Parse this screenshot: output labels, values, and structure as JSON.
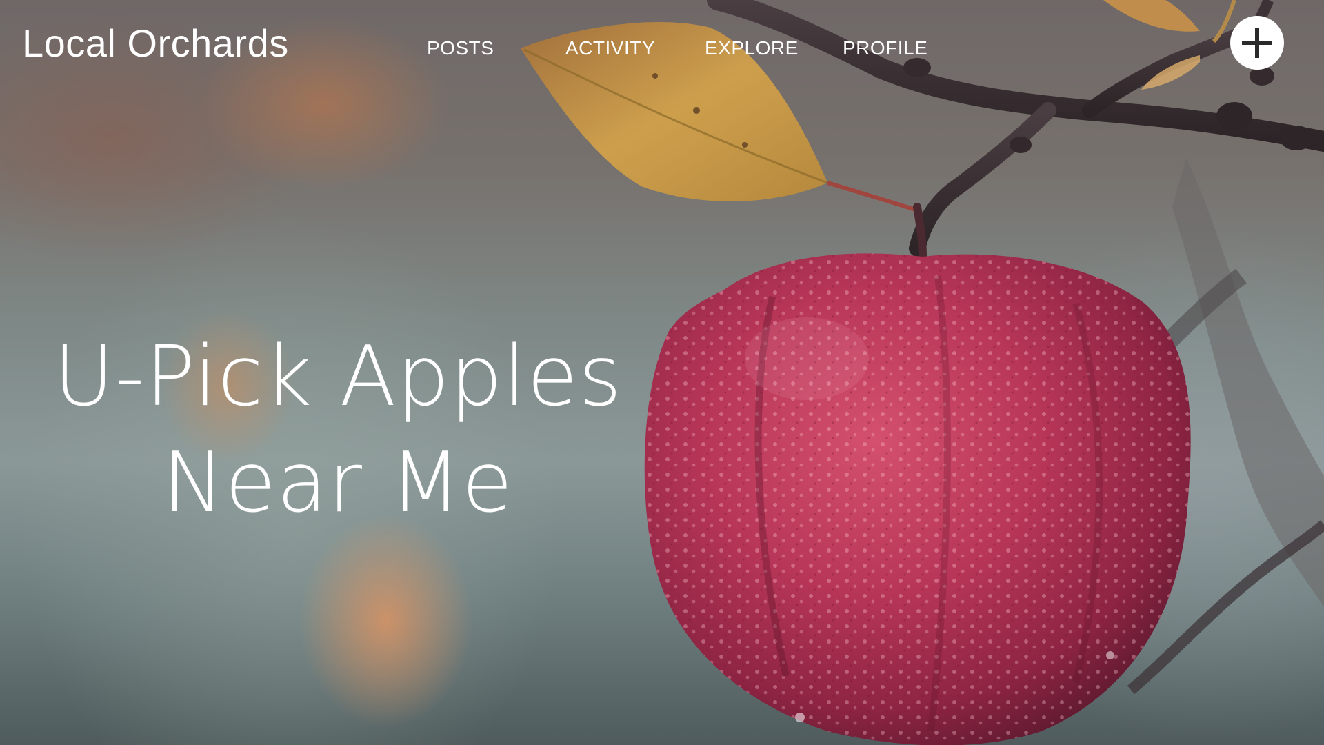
{
  "site": {
    "brand": "Local Orchards"
  },
  "nav": {
    "items": [
      {
        "label": "POSTS"
      },
      {
        "label": "ACTIVITY"
      },
      {
        "label": "EXPLORE"
      },
      {
        "label": "PROFILE"
      }
    ],
    "add_button_icon": "plus-icon"
  },
  "hero": {
    "title_line_1": "U-Pick Apples",
    "title_line_2": "Near Me",
    "image": "apple-on-branch-photo"
  },
  "colors": {
    "text": "#ffffff",
    "apple": "#b2304f",
    "leaf": "#c4903a",
    "branch": "#3e3236"
  }
}
